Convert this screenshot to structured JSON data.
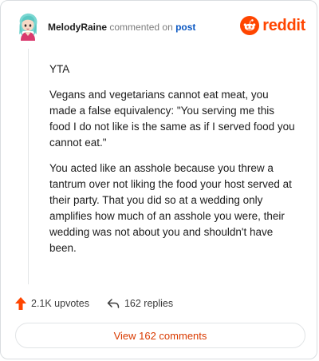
{
  "header": {
    "username": "MelodyRaine",
    "action_text": "commented on",
    "target_text": "post",
    "brand": "reddit"
  },
  "comment": {
    "paragraphs": [
      "YTA",
      "Vegans and vegetarians cannot eat meat, you made a false equivalency: \"You serving me this food I do not like is the same as if I served food you cannot eat.\"",
      "You acted like an asshole because you threw a tantrum over not liking the food your host served at their party. That you did so at a wedding only amplifies how much of an asshole you were, their wedding was not about you and shouldn't have been."
    ]
  },
  "actions": {
    "upvotes": "2.1K upvotes",
    "replies": "162 replies"
  },
  "footer": {
    "view_comments": "View 162 comments"
  },
  "icons": {
    "avatar": "avatar-icon",
    "brand": "reddit-snoo-icon",
    "upvote": "upvote-arrow-icon",
    "reply": "reply-arrow-icon"
  },
  "colors": {
    "brand": "#ff4500",
    "link": "#0a57c2",
    "button_text": "#d93a00"
  }
}
